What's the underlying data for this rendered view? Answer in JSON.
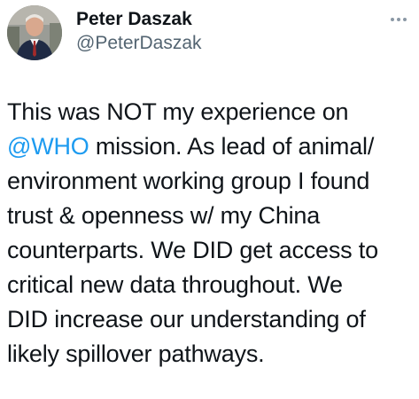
{
  "author": {
    "display_name": "Peter Daszak",
    "handle": "@PeterDaszak"
  },
  "icons": {
    "more": "more-horizontal-icon",
    "avatar": "profile-photo"
  },
  "colors": {
    "mention": "#1d9bf0",
    "text": "#0f1419",
    "secondary": "#536471"
  },
  "tweet": {
    "lines": [
      {
        "text": "This was NOT my experience on"
      },
      {
        "mention": "@WHO",
        "text": " mission. As lead of animal/"
      },
      {
        "text": "environment working group I found"
      },
      {
        "text": "trust & openness w/ my China"
      },
      {
        "text": "counterparts. We DID get access to"
      },
      {
        "text": "critical new data throughout. We"
      },
      {
        "text": "DID increase our understanding of"
      },
      {
        "text": "likely spillover pathways."
      }
    ]
  }
}
